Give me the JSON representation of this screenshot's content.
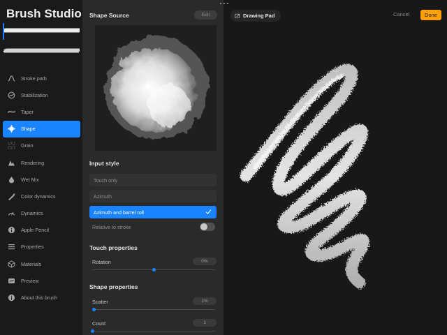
{
  "app": {
    "title": "Brush Studio"
  },
  "sidebar": {
    "items": [
      {
        "label": "Stroke path",
        "icon": "stroke-path-icon",
        "active": false
      },
      {
        "label": "Stabilization",
        "icon": "stabilization-icon",
        "active": false
      },
      {
        "label": "Taper",
        "icon": "taper-icon",
        "active": false
      },
      {
        "label": "Shape",
        "icon": "shape-icon",
        "active": true
      },
      {
        "label": "Grain",
        "icon": "grain-icon",
        "active": false
      },
      {
        "label": "Rendering",
        "icon": "rendering-icon",
        "active": false
      },
      {
        "label": "Wet Mix",
        "icon": "wet-mix-icon",
        "active": false
      },
      {
        "label": "Color dynamics",
        "icon": "color-dynamics-icon",
        "active": false
      },
      {
        "label": "Dynamics",
        "icon": "dynamics-icon",
        "active": false
      },
      {
        "label": "Apple Pencil",
        "icon": "apple-pencil-icon",
        "active": false
      },
      {
        "label": "Properties",
        "icon": "properties-icon",
        "active": false
      },
      {
        "label": "Materials",
        "icon": "materials-icon",
        "active": false
      },
      {
        "label": "Preview",
        "icon": "preview-icon",
        "active": false
      },
      {
        "label": "About this brush",
        "icon": "about-icon",
        "active": false
      }
    ]
  },
  "panel": {
    "shape_source": {
      "title": "Shape Source",
      "edit_label": "Edit"
    },
    "input_style": {
      "title": "Input style",
      "options": [
        {
          "label": "Touch only",
          "selected": false
        },
        {
          "label": "Azimuth",
          "selected": false
        },
        {
          "label": "Azimuth and barrel roll",
          "selected": true
        }
      ],
      "relative_to_stroke": {
        "label": "Relative to stroke",
        "on": false
      }
    },
    "touch_properties": {
      "title": "Touch properties",
      "rotation": {
        "label": "Rotation",
        "value": "0%",
        "level": 0.5
      }
    },
    "shape_properties": {
      "title": "Shape properties",
      "scatter": {
        "label": "Scatter",
        "value": "1%",
        "level": 0.01
      },
      "count": {
        "label": "Count",
        "value": "1",
        "level": 0.0
      }
    }
  },
  "drawing_pad": {
    "tab_label": "Drawing Pad",
    "cancel_label": "Cancel",
    "done_label": "Done"
  },
  "colors": {
    "accent": "#1a83ff",
    "done": "#ff9f0a"
  }
}
